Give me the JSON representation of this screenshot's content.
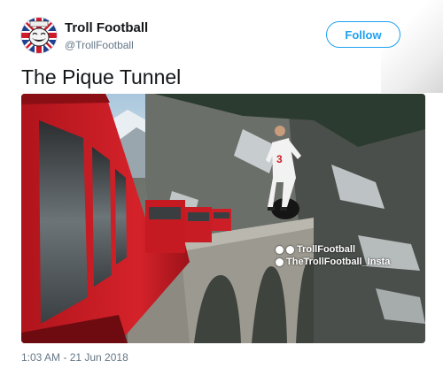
{
  "account": {
    "display_name": "Troll Football",
    "handle": "@TrollFootball",
    "avatar_icon": "troll-face-union-jack-avatar"
  },
  "follow_button": {
    "label": "Follow",
    "color": "#1da1f2"
  },
  "tweet": {
    "text": "The Pique Tunnel",
    "timestamp": "1:03 AM - 21 Jun 2018"
  },
  "media": {
    "description_icon": "photo-train-viaduct",
    "watermark_line1": "TrollFootball",
    "watermark_line2": "TheTrollFootball_Insta",
    "jersey_number": "3"
  },
  "colors": {
    "name_text": "#14171a",
    "secondary_text": "#657786",
    "accent": "#1da1f2"
  }
}
